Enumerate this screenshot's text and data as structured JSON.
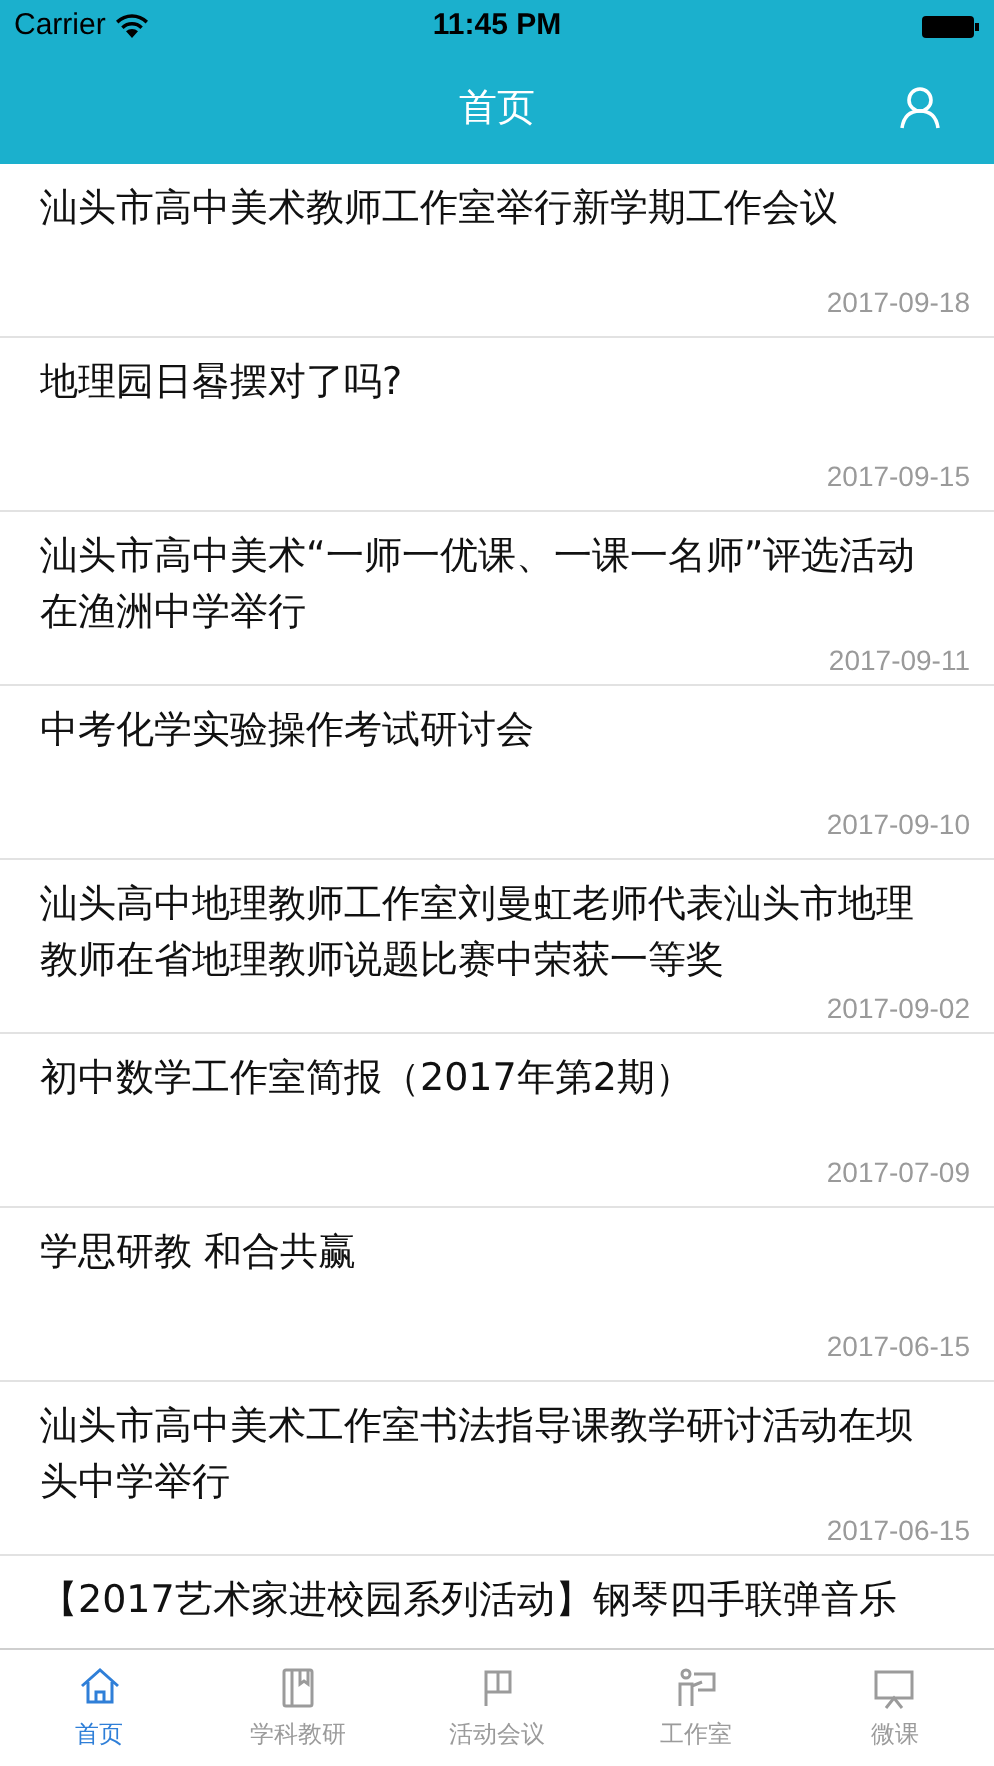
{
  "status_bar": {
    "carrier": "Carrier",
    "time": "11:45 PM"
  },
  "nav_bar": {
    "title": "首页"
  },
  "articles": [
    {
      "title": "汕头市高中美术教师工作室举行新学期工作会议",
      "date": "2017-09-18"
    },
    {
      "title": "地理园日晷摆对了吗?",
      "date": "2017-09-15"
    },
    {
      "title": "汕头市高中美术“一师一优课、一课一名师”评选活动在渔洲中学举行",
      "date": "2017-09-11"
    },
    {
      "title": "中考化学实验操作考试研讨会",
      "date": "2017-09-10"
    },
    {
      "title": "汕头高中地理教师工作室刘曼虹老师代表汕头市地理教师在省地理教师说题比赛中荣获一等奖",
      "date": "2017-09-02"
    },
    {
      "title": "初中数学工作室简报（2017年第2期）",
      "date": "2017-07-09"
    },
    {
      "title": "学思研教 和合共赢",
      "date": "2017-06-15"
    },
    {
      "title": "汕头市高中美术工作室书法指导课教学研讨活动在坝头中学举行",
      "date": "2017-06-15"
    },
    {
      "title": "【2017艺术家进校园系列活动】钢琴四手联弹音乐"
    }
  ],
  "tab_bar": [
    {
      "kind": "home",
      "label": "首页",
      "selected": true
    },
    {
      "kind": "book",
      "label": "学科教研",
      "selected": false
    },
    {
      "kind": "flag",
      "label": "活动会议",
      "selected": false
    },
    {
      "kind": "teacher",
      "label": "工作室",
      "selected": false
    },
    {
      "kind": "screen",
      "label": "微课",
      "selected": false
    }
  ]
}
